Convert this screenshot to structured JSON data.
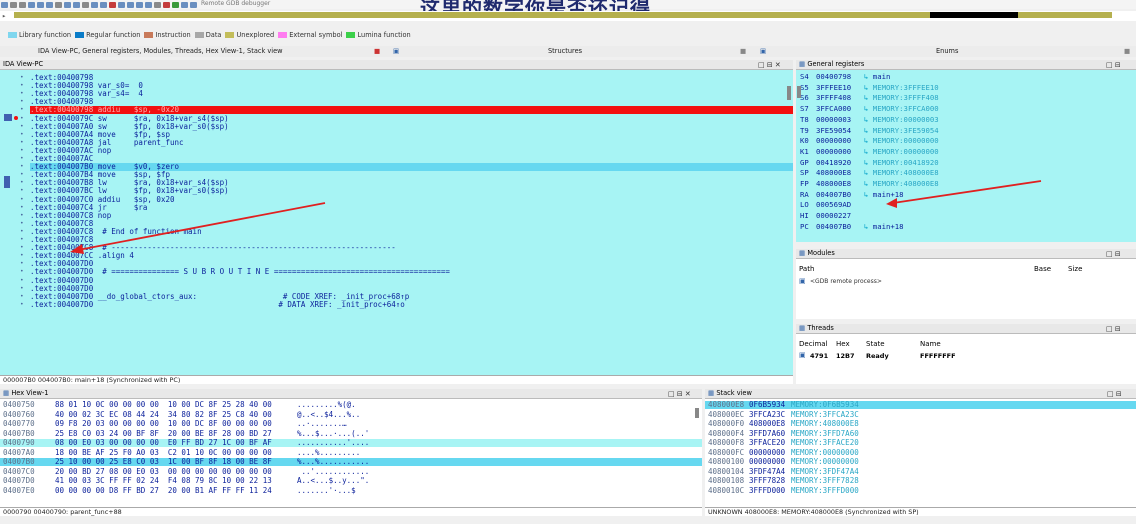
{
  "overlay_text": "这里的数字你是否还记得",
  "toolbar": {
    "debugger_label": "Remote GDB debugger"
  },
  "legend": [
    {
      "label": "Library function",
      "color": "#7fd6ee"
    },
    {
      "label": "Regular function",
      "color": "#0a7cc8"
    },
    {
      "label": "Instruction",
      "color": "#c87a5a"
    },
    {
      "label": "Data",
      "color": "#a8a8a8"
    },
    {
      "label": "Unexplored",
      "color": "#c3bd5a"
    },
    {
      "label": "External symbol",
      "color": "#ff7cf0"
    },
    {
      "label": "Lumina function",
      "color": "#3cd04a"
    }
  ],
  "tabs": {
    "main": "IDA View-PC, General registers, Modules, Threads, Hex View-1, Stack view",
    "structures": "Structures",
    "enums": "Enums"
  },
  "ida": {
    "title": "IDA View-PC",
    "status": "000007B0 004007B0: main+18 (Synchronized with PC)",
    "lines": [
      {
        "text": ".text:00400798",
        "hl": ""
      },
      {
        "text": ".text:00400798 var_s0=  0",
        "hl": ""
      },
      {
        "text": ".text:00400798 var_s4=  4",
        "hl": ""
      },
      {
        "text": ".text:00400798",
        "hl": ""
      },
      {
        "text": ".text:00400798 addiu   $sp, -0x20",
        "hl": "red"
      },
      {
        "text": ".text:0040079C sw      $ra, 0x18+var_s4($sp)",
        "hl": ""
      },
      {
        "text": ".text:004007A0 sw      $fp, 0x18+var_s0($sp)",
        "hl": ""
      },
      {
        "text": ".text:004007A4 move    $fp, $sp",
        "hl": ""
      },
      {
        "text": ".text:004007A8 jal     parent_func",
        "hl": ""
      },
      {
        "text": ".text:004007AC nop",
        "hl": ""
      },
      {
        "text": ".text:004007AC",
        "hl": ""
      },
      {
        "text": ".text:004007B0 move    $v0, $zero",
        "hl": "blue"
      },
      {
        "text": ".text:004007B4 move    $sp, $fp",
        "hl": ""
      },
      {
        "text": ".text:004007B8 lw      $ra, 0x18+var_s4($sp)",
        "hl": ""
      },
      {
        "text": ".text:004007BC lw      $fp, 0x18+var_s0($sp)",
        "hl": ""
      },
      {
        "text": ".text:004007C0 addiu   $sp, 0x20",
        "hl": ""
      },
      {
        "text": ".text:004007C4 jr      $ra",
        "hl": ""
      },
      {
        "text": ".text:004007C8 nop",
        "hl": ""
      },
      {
        "text": ".text:004007C8",
        "hl": ""
      },
      {
        "text": ".text:004007C8  # End of function main",
        "hl": ""
      },
      {
        "text": ".text:004007C8",
        "hl": ""
      },
      {
        "text": ".text:004007C8  # ---------------------------------------------------------------",
        "hl": ""
      },
      {
        "text": ".text:004007CC .align 4",
        "hl": ""
      },
      {
        "text": ".text:004007D0",
        "hl": ""
      },
      {
        "text": ".text:004007D0  # =============== S U B R O U T I N E =======================================",
        "hl": ""
      },
      {
        "text": ".text:004007D0",
        "hl": ""
      },
      {
        "text": ".text:004007D0",
        "hl": ""
      },
      {
        "text": ".text:004007D0 __do_global_ctors_aux:                   # CODE XREF: _init_proc+68↑p",
        "hl": ""
      },
      {
        "text": ".text:004007D0                                         # DATA XREF: _init_proc+64↑o",
        "hl": ""
      }
    ]
  },
  "registers": {
    "title": "General registers",
    "rows": [
      {
        "name": "S4",
        "value": "00400798",
        "target": "main"
      },
      {
        "name": "S5",
        "value": "3FFFEE10",
        "target": "MEMORY:3FFFEE10"
      },
      {
        "name": "S6",
        "value": "3FFFF408",
        "target": "MEMORY:3FFFF408"
      },
      {
        "name": "S7",
        "value": "3FFCA000",
        "target": "MEMORY:3FFCA000"
      },
      {
        "name": "T8",
        "value": "00000003",
        "target": "MEMORY:00000003"
      },
      {
        "name": "T9",
        "value": "3FE59054",
        "target": "MEMORY:3FE59054"
      },
      {
        "name": "K0",
        "value": "00000000",
        "target": "MEMORY:00000000"
      },
      {
        "name": "K1",
        "value": "00000000",
        "target": "MEMORY:00000000"
      },
      {
        "name": "GP",
        "value": "00418920",
        "target": "MEMORY:00418920"
      },
      {
        "name": "SP",
        "value": "408000E8",
        "target": "MEMORY:408000E8"
      },
      {
        "name": "FP",
        "value": "408000E8",
        "target": "MEMORY:408000E8"
      },
      {
        "name": "RA",
        "value": "004007B0",
        "target": "main+18"
      },
      {
        "name": "LO",
        "value": "000569AD",
        "target": ""
      },
      {
        "name": "HI",
        "value": "00000227",
        "target": ""
      },
      {
        "name": "PC",
        "value": "004007B0",
        "target": "main+18"
      }
    ]
  },
  "modules": {
    "title": "Modules",
    "col_path": "Path",
    "col_base": "Base",
    "col_size": "Size",
    "row_path": "<GDB remote process>"
  },
  "threads": {
    "title": "Threads",
    "cols": [
      "Decimal",
      "Hex",
      "State",
      "Name"
    ],
    "row": [
      "4791",
      "12B7",
      "Ready",
      "FFFFFFFF"
    ]
  },
  "hex": {
    "title": "Hex View-1",
    "status": "0000790 00400790: parent_func+88",
    "rows": [
      {
        "addr": "0400750",
        "bytes": "88 01 10 0C 00 00 00 00  10 00 DC 8F 25 28 40 00",
        "ascii": ".........%(@.",
        "hl": ""
      },
      {
        "addr": "0400760",
        "bytes": "40 00 02 3C EC 08 44 24  34 80 82 8F 25 C8 40 00",
        "ascii": "@..<..$4...%..",
        "hl": ""
      },
      {
        "addr": "0400770",
        "bytes": "09 F8 20 03 00 00 00 00  10 00 DC 8F 00 00 00 00",
        "ascii": "..·.......…",
        "hl": ""
      },
      {
        "addr": "04007B0",
        "bytes": "25 E8 C0 03 24 00 BF 8F  20 00 BE 8F 28 00 BD 27",
        "ascii": "%...$...·...(..'",
        "hl": ""
      },
      {
        "addr": "0400790",
        "bytes": "08 00 E0 03 00 00 00 00  E0 FF BD 27 1C 00 BF AF",
        "ascii": "...........'....",
        "hl": "sel"
      },
      {
        "addr": "04007A0",
        "bytes": "18 00 BE AF 25 F0 A0 03  C2 01 10 0C 00 00 00 00",
        "ascii": "....%.........",
        "hl": ""
      },
      {
        "addr": "04007B0",
        "bytes": "25 10 00 00 25 E8 C0 03  1C 00 BF 8F 18 00 BE 8F",
        "ascii": "%...%...........",
        "hl": "blue"
      },
      {
        "addr": "04007C0",
        "bytes": "20 00 BD 27 08 00 E0 03  00 00 00 00 00 00 00 00",
        "ascii": " ..'............",
        "hl": ""
      },
      {
        "addr": "04007D0",
        "bytes": "41 00 03 3C FF FF 02 24  F4 08 79 8C 10 00 22 13",
        "ascii": "A..<...$..y...\".",
        "hl": ""
      },
      {
        "addr": "04007E0",
        "bytes": "00 00 00 00 D8 FF BD 27  20 00 B1 AF FF FF 11 24",
        "ascii": ".......'·...$",
        "hl": ""
      }
    ]
  },
  "stack": {
    "title": "Stack view",
    "status": "UNKNOWN 408000E8: MEMORY:408000E8 (Synchronized with SP)",
    "rows": [
      {
        "addr": "408000E8",
        "value": "0F6B5934",
        "target": "MEMORY:0F6B5934",
        "hl": "blue"
      },
      {
        "addr": "408000EC",
        "value": "3FFCA23C",
        "target": "MEMORY:3FFCA23C",
        "hl": ""
      },
      {
        "addr": "408000F0",
        "value": "408000E8",
        "target": "MEMORY:408000E8",
        "hl": ""
      },
      {
        "addr": "408000F4",
        "value": "3FFD7A60",
        "target": "MEMORY:3FFD7A60",
        "hl": ""
      },
      {
        "addr": "408000F8",
        "value": "3FFACE20",
        "target": "MEMORY:3FFACE20",
        "hl": ""
      },
      {
        "addr": "408000FC",
        "value": "00000000",
        "target": "MEMORY:00000000",
        "hl": ""
      },
      {
        "addr": "40800100",
        "value": "00000000",
        "target": "MEMORY:00000000",
        "hl": ""
      },
      {
        "addr": "40800104",
        "value": "3FDF47A4",
        "target": "MEMORY:3FDF47A4",
        "hl": ""
      },
      {
        "addr": "40800108",
        "value": "3FFF7828",
        "target": "MEMORY:3FFF7828",
        "hl": ""
      },
      {
        "addr": "4080010C",
        "value": "3FFFD000",
        "target": "MEMORY:3FFFD000",
        "hl": ""
      }
    ]
  },
  "colors": {
    "accent_red": "#f21010",
    "accent_blue": "#66d8f0",
    "panel_cyan": "#a7f4f4",
    "arrow": "#e02020"
  }
}
